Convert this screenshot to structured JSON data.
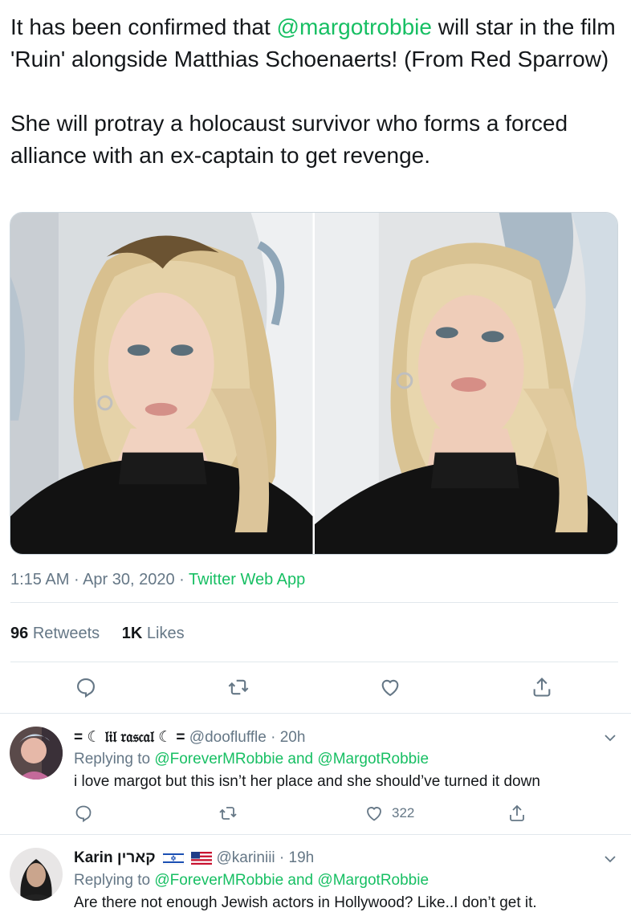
{
  "tweet": {
    "line1_pre": "It has been confirmed that ",
    "line1_mention": "@margotrobbie",
    "line1_post": " will star in the film 'Ruin' alongside Matthias Schoenaerts! (From Red Sparrow)",
    "line2": "She will protray a holocaust survivor who forms a forced alliance with an ex-captain to get revenge."
  },
  "media": {
    "photos": [
      {
        "alt": "photo-1"
      },
      {
        "alt": "photo-2"
      }
    ]
  },
  "meta": {
    "time": "1:15 AM",
    "sep1": " · ",
    "date": "Apr 30, 2020",
    "sep2": " · ",
    "source": "Twitter Web App"
  },
  "stats": {
    "retweets_count": "96",
    "retweets_label": "Retweets",
    "likes_count": "1K",
    "likes_label": "Likes"
  },
  "actions": {
    "icons": [
      "reply-icon",
      "retweet-icon",
      "like-icon",
      "share-icon"
    ]
  },
  "replies": [
    {
      "display_name": "= ☾ 𝔩𝔦𝔩 𝔯𝔞𝔰𝔠𝔞𝔩 ☾ =",
      "handle": "@doofluffle",
      "sep": " · ",
      "time": "20h",
      "replying_prefix": "Replying to ",
      "replying_user1": "@ForeverMRobbie",
      "replying_and": " and ",
      "replying_user2": "@MargotRobbie",
      "text": "i love margot but this isn’t her place and she should’ve turned it down",
      "likes": "322"
    },
    {
      "display_name": "Karin קארין",
      "handle": "@kariniii",
      "sep": " · ",
      "time": "19h",
      "replying_prefix": "Replying to ",
      "replying_user1": "@ForeverMRobbie",
      "replying_and": " and ",
      "replying_user2": "@MargotRobbie",
      "text": "Are there not enough Jewish actors in Hollywood? Like..I don’t get it.",
      "flags": [
        "israel-flag-icon",
        "us-flag-icon"
      ]
    }
  ],
  "colors": {
    "accent": "#17bf63",
    "secondary_text": "#657786",
    "primary_text": "#14171a",
    "divider": "#e1e8ed"
  }
}
